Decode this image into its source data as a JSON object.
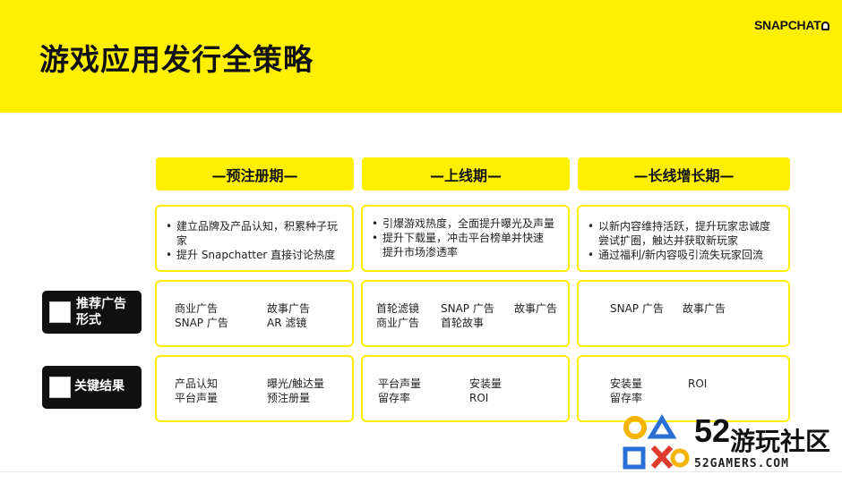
{
  "title": "游戏应用发行全策略",
  "brand": "SNAPCHAT",
  "colors": {
    "accent": "#fef000",
    "label_bg": "#111111"
  },
  "phases": [
    "—预注册期—",
    "—上线期—",
    "—长线增长期—"
  ],
  "goals": [
    [
      "建立品牌及产品认知，积累种子玩家",
      "提升 Snapchatter 直接讨论热度"
    ],
    [
      "引爆游戏热度，全面提升曝光及声量",
      "提升下载量，冲击平台榜单并快速提升市场渗透率"
    ],
    [
      "以新内容维持活跃，提升玩家忠诚度尝试扩圈，触达并获取新玩家",
      "通过福利/新内容吸引流失玩家回流"
    ]
  ],
  "rows": {
    "ads": {
      "label_line1": "推荐广告",
      "label_line2": "形式",
      "cells": [
        [
          "商业广告",
          "故事广告",
          "SNAP 广告",
          "AR 滤镜"
        ],
        [
          "首轮滤镜",
          "SNAP 广告",
          "故事广告",
          "商业广告",
          "首轮故事"
        ],
        [
          "SNAP 广告",
          "故事广告"
        ]
      ]
    },
    "results": {
      "label": "关键结果",
      "cells": [
        [
          "产品认知",
          "曝光/触达量",
          "平台声量",
          "预注册量"
        ],
        [
          "平台声量",
          "安装量",
          "留存率",
          "ROI"
        ],
        [
          "安装量",
          "ROI",
          "留存率"
        ]
      ]
    }
  },
  "watermark": {
    "number": "52",
    "text": "游玩社区",
    "url": "52GAMERS.COM",
    "colors": [
      "#f5b400",
      "#2a6fd6",
      "#e03a2f"
    ]
  }
}
